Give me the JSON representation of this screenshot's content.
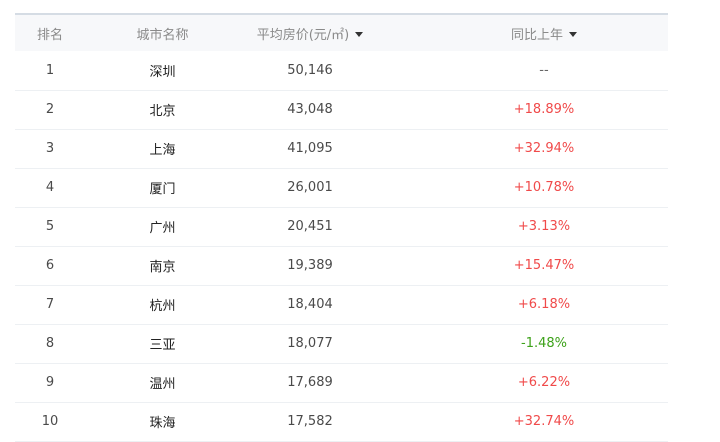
{
  "headers": {
    "rank": "排名",
    "city": "城市名称",
    "price": "平均房价(元/㎡)",
    "yoy": "同比上年"
  },
  "rows": [
    {
      "rank": "1",
      "city": "深圳",
      "price": "50,146",
      "yoy": "--",
      "trend": "neu"
    },
    {
      "rank": "2",
      "city": "北京",
      "price": "43,048",
      "yoy": "+18.89%",
      "trend": "pos"
    },
    {
      "rank": "3",
      "city": "上海",
      "price": "41,095",
      "yoy": "+32.94%",
      "trend": "pos"
    },
    {
      "rank": "4",
      "city": "厦门",
      "price": "26,001",
      "yoy": "+10.78%",
      "trend": "pos"
    },
    {
      "rank": "5",
      "city": "广州",
      "price": "20,451",
      "yoy": "+3.13%",
      "trend": "pos"
    },
    {
      "rank": "6",
      "city": "南京",
      "price": "19,389",
      "yoy": "+15.47%",
      "trend": "pos"
    },
    {
      "rank": "7",
      "city": "杭州",
      "price": "18,404",
      "yoy": "+6.18%",
      "trend": "pos"
    },
    {
      "rank": "8",
      "city": "三亚",
      "price": "18,077",
      "yoy": "-1.48%",
      "trend": "neg"
    },
    {
      "rank": "9",
      "city": "温州",
      "price": "17,689",
      "yoy": "+6.22%",
      "trend": "pos"
    },
    {
      "rank": "10",
      "city": "珠海",
      "price": "17,582",
      "yoy": "+32.74%",
      "trend": "pos"
    }
  ],
  "colors": {
    "positive": "#f04a4a",
    "negative": "#3da21a",
    "neutral": "#666666"
  }
}
